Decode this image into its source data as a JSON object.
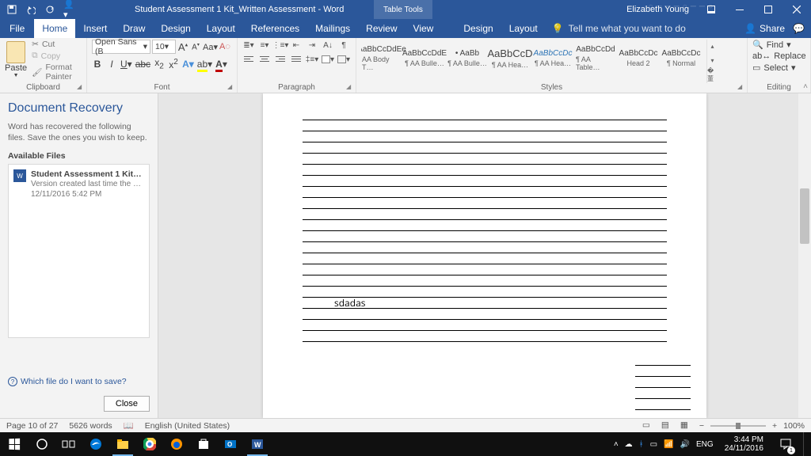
{
  "title": "Student Assessment 1 Kit_Written Assessment  -  Word",
  "tabletools": "Table Tools",
  "user": "Elizabeth Young",
  "tabs": {
    "file": "File",
    "list": [
      "Home",
      "Insert",
      "Draw",
      "Design",
      "Layout",
      "References",
      "Mailings",
      "Review",
      "View"
    ],
    "context": [
      "Design",
      "Layout"
    ],
    "active": "Home"
  },
  "tellme": "Tell me what you want to do",
  "share": "Share",
  "clipboard": {
    "paste": "Paste",
    "cut": "Cut",
    "copy": "Copy",
    "painter": "Format Painter",
    "label": "Clipboard"
  },
  "font": {
    "name": "Open Sans (B",
    "size": "10",
    "label": "Font"
  },
  "paragraph": {
    "label": "Paragraph"
  },
  "styles": {
    "label": "Styles",
    "items": [
      {
        "preview": "AaBbCcDdEe",
        "name": "AA Body T…",
        "color": "#444"
      },
      {
        "preview": "AaBbCcDdE",
        "name": "¶ AA Bulle…",
        "color": "#444"
      },
      {
        "preview": "•  AaBb",
        "name": "¶ AA Bulle…",
        "color": "#444"
      },
      {
        "preview": "AaBbCcD",
        "name": "¶ AA Hea…",
        "color": "#444",
        "big": true
      },
      {
        "preview": "AaBbCcDc",
        "name": "¶ AA Hea…",
        "color": "#2e75b6",
        "italic": true
      },
      {
        "preview": "AaBbCcDd",
        "name": "¶ AA Table…",
        "color": "#444"
      },
      {
        "preview": "AaBbCcDc",
        "name": "Head 2",
        "color": "#444"
      },
      {
        "preview": "AaBbCcDc",
        "name": "¶ Normal",
        "color": "#444"
      }
    ]
  },
  "editing": {
    "find": "Find",
    "replace": "Replace",
    "select": "Select",
    "label": "Editing"
  },
  "recovery": {
    "title": "Document Recovery",
    "desc": "Word has recovered the following files. Save the ones you wish to keep.",
    "avail": "Available Files",
    "file": {
      "name": "Student Assessment 1 Kit…",
      "meta1": "Version created last time the us…",
      "meta2": "12/11/2016 5:42 PM"
    },
    "help": "Which file do I want to save?",
    "close": "Close"
  },
  "doc": {
    "typed": "sdadas"
  },
  "status": {
    "page": "Page 10 of 27",
    "words": "5626 words",
    "lang": "English (United States)",
    "zoom": "100%"
  },
  "taskbar": {
    "time": "3:44 PM",
    "date": "24/11/2016",
    "lang": "ENG",
    "notif": "1"
  }
}
